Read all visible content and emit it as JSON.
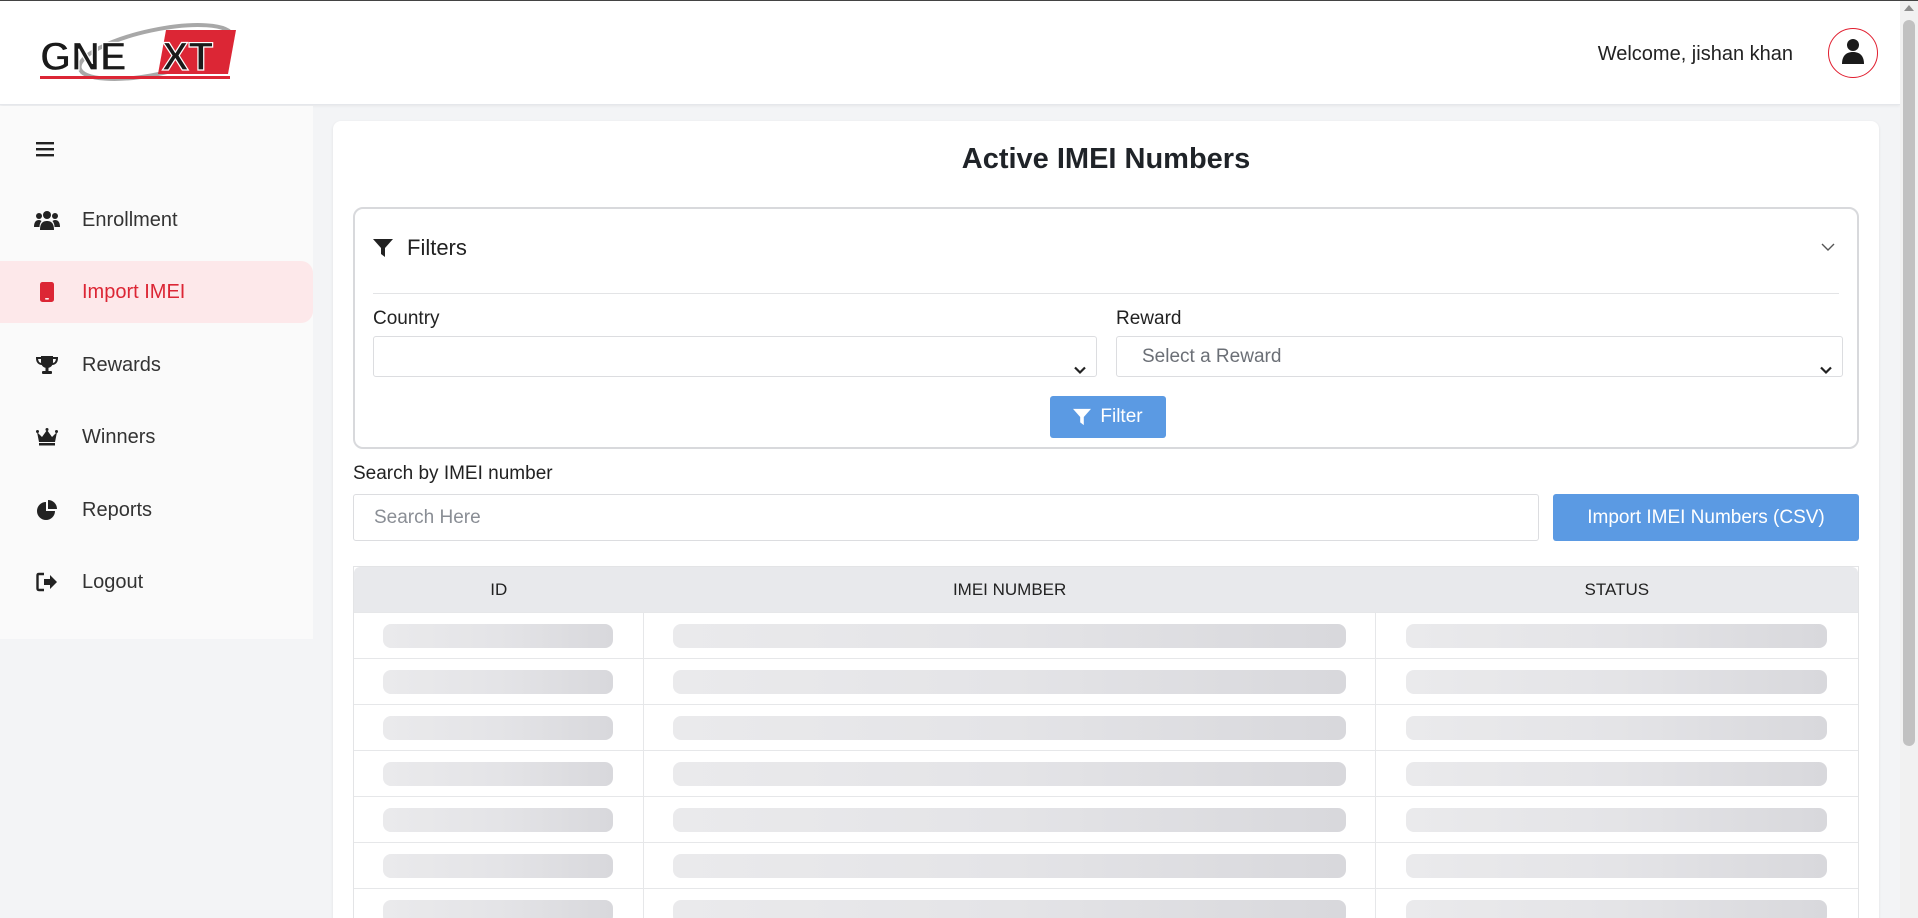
{
  "header": {
    "logo_text": "GNEXT",
    "welcome": "Welcome, jishan khan"
  },
  "sidebar": {
    "items": [
      {
        "label": "Enrollment",
        "icon": "users-icon"
      },
      {
        "label": "Import IMEI",
        "icon": "mobile-icon",
        "active": true
      },
      {
        "label": "Rewards",
        "icon": "trophy-icon"
      },
      {
        "label": "Winners",
        "icon": "crown-icon"
      },
      {
        "label": "Reports",
        "icon": "pie-chart-icon"
      },
      {
        "label": "Logout",
        "icon": "logout-icon"
      }
    ]
  },
  "main": {
    "title": "Active IMEI Numbers",
    "filters": {
      "heading": "Filters",
      "country_label": "Country",
      "country_value": "",
      "reward_label": "Reward",
      "reward_placeholder": "Select a Reward",
      "filter_button": "Filter"
    },
    "search": {
      "label": "Search by IMEI number",
      "placeholder": "Search Here"
    },
    "import_button": "Import IMEI Numbers (CSV)",
    "table": {
      "columns": [
        "ID",
        "IMEI NUMBER",
        "STATUS"
      ],
      "loading_rows": 7
    }
  },
  "colors": {
    "brand_red": "#dc2635",
    "active_bg": "#fde8ea",
    "button_blue": "#5b9ae3"
  }
}
